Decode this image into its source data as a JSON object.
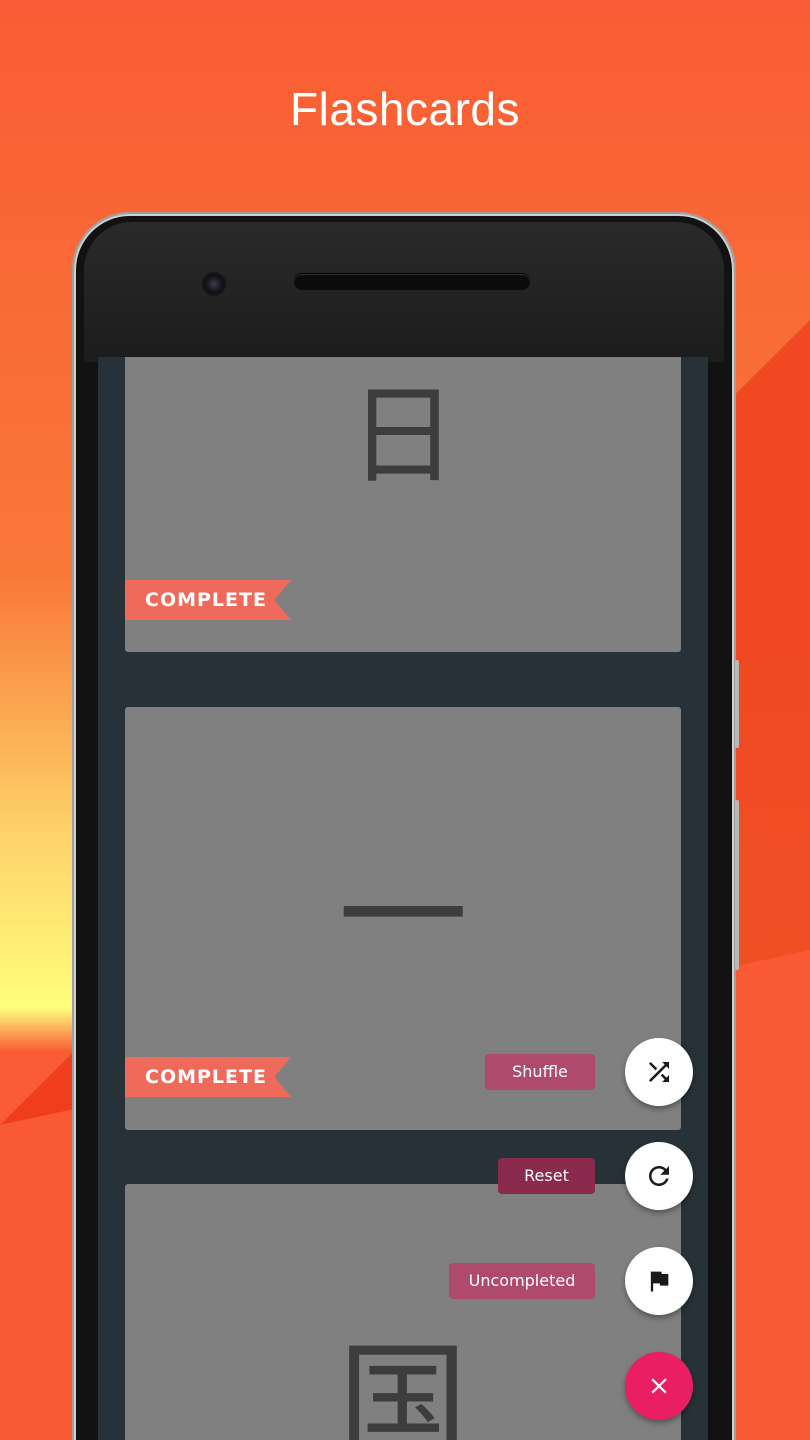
{
  "headline": "Flashcards",
  "cards": [
    {
      "character": "日",
      "badge": "COMPLETE"
    },
    {
      "character": "一",
      "badge": "COMPLETE"
    },
    {
      "character": "国",
      "badge": ""
    }
  ],
  "fab_menu": {
    "shuffle": {
      "label": "Shuffle",
      "icon": "shuffle-icon"
    },
    "reset": {
      "label": "Reset",
      "icon": "refresh-icon"
    },
    "uncompleted": {
      "label": "Uncompleted",
      "icon": "flag-icon"
    },
    "close": {
      "icon": "close-icon"
    }
  },
  "colors": {
    "background": "#f95c34",
    "screen_bg": "#263238",
    "card_bg": "#808080",
    "ribbon": "#ef6a5b",
    "fab_label": "#b04a6c",
    "fab_close": "#e91e63"
  }
}
